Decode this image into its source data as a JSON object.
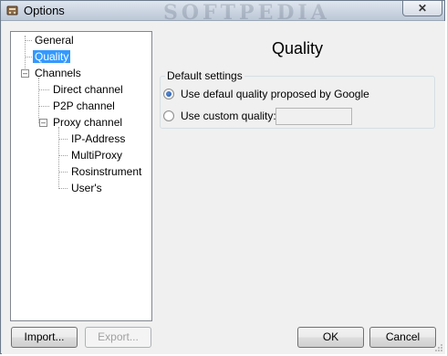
{
  "window": {
    "title": "Options",
    "close_glyph": "✕",
    "watermark": "SOFTPEDIA"
  },
  "tree": {
    "items": [
      {
        "label": "General",
        "level": 1
      },
      {
        "label": "Quality",
        "level": 1,
        "selected": true
      },
      {
        "label": "Channels",
        "level": 0,
        "expanded": true
      },
      {
        "label": "Direct channel",
        "level": 2
      },
      {
        "label": "P2P channel",
        "level": 2
      },
      {
        "label": "Proxy channel",
        "level": 2,
        "expanded": true
      },
      {
        "label": "IP-Address",
        "level": 3
      },
      {
        "label": "MultiProxy",
        "level": 3
      },
      {
        "label": "Rosinstrument",
        "level": 3
      },
      {
        "label": "User's",
        "level": 3
      }
    ]
  },
  "page": {
    "title": "Quality",
    "group_label": "Default settings",
    "option_default": "Use defaul quality proposed by Google",
    "option_custom": "Use custom quality:",
    "custom_value": ""
  },
  "buttons": {
    "import": "Import...",
    "export": "Export...",
    "ok": "OK",
    "cancel": "Cancel"
  },
  "icons": {
    "app": "options-app-icon",
    "close": "close-icon",
    "expander_minus": "collapse-icon",
    "resize": "resize-grip-icon"
  }
}
